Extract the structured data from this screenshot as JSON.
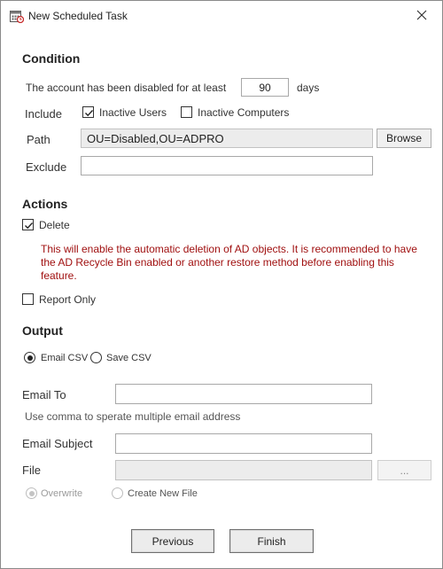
{
  "window": {
    "title": "New Scheduled Task"
  },
  "condition": {
    "heading": "Condition",
    "disabled_prefix": "The account has been disabled for at least",
    "days_value": "90",
    "days_suffix": "days",
    "include_label": "Include",
    "inactive_users": {
      "label": "Inactive Users",
      "checked": true
    },
    "inactive_computers": {
      "label": "Inactive Computers",
      "checked": false
    },
    "path_label": "Path",
    "path_value": "OU=Disabled,OU=ADPRO",
    "browse_label": "Browse",
    "exclude_label": "Exclude",
    "exclude_value": ""
  },
  "actions": {
    "heading": "Actions",
    "delete": {
      "label": "Delete",
      "checked": true
    },
    "warning": "This will enable the automatic deletion of AD objects. It is recommended to have the AD Recycle Bin enabled or another restore method before enabling this feature.",
    "report_only": {
      "label": "Report Only",
      "checked": false
    }
  },
  "output": {
    "heading": "Output",
    "email_csv": {
      "label": "Email CSV",
      "selected": true
    },
    "save_csv": {
      "label": "Save CSV",
      "selected": false
    },
    "email_to_label": "Email To",
    "email_to_value": "",
    "email_hint": "Use comma to sperate multiple email address",
    "email_subject_label": "Email Subject",
    "email_subject_value": "",
    "file_label": "File",
    "file_value": "",
    "file_browse_label": "...",
    "overwrite": {
      "label": "Overwrite",
      "selected": true
    },
    "create_new": {
      "label": "Create New File",
      "selected": false
    }
  },
  "footer": {
    "previous_label": "Previous",
    "finish_label": "Finish"
  },
  "icons": {
    "title": "calendar-clock-icon",
    "close": "close-icon",
    "check": "checkmark-icon"
  }
}
